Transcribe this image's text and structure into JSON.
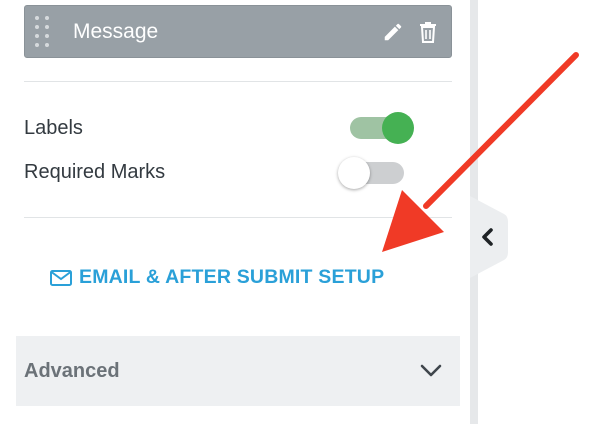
{
  "field": {
    "label": "Message",
    "drag_handle_icon": "drag-handle-icon",
    "edit_icon": "pencil-icon",
    "delete_icon": "trash-icon"
  },
  "options": {
    "labels": {
      "label": "Labels",
      "enabled": true
    },
    "required_marks": {
      "label": "Required Marks",
      "enabled": false
    }
  },
  "email_setup": {
    "label": "EMAIL & AFTER SUBMIT SETUP",
    "icon": "envelope-icon"
  },
  "advanced": {
    "label": "Advanced",
    "icon": "chevron-down-icon"
  },
  "collapse": {
    "icon": "chevron-left-icon"
  },
  "colors": {
    "accent": "#2aa0d8",
    "toggle_on": "#45b153",
    "annotation_arrow": "#f03a26"
  }
}
